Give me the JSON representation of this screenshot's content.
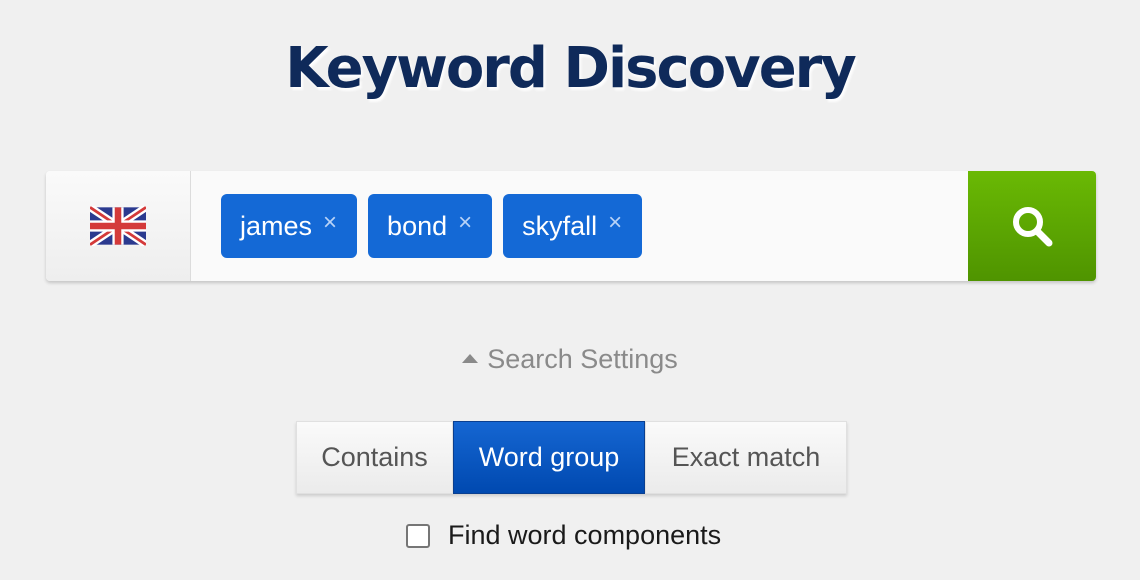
{
  "header": {
    "title": "Keyword Discovery"
  },
  "search": {
    "country_icon": "uk-flag-icon",
    "keywords": [
      {
        "label": "james",
        "remove": "×"
      },
      {
        "label": "bond",
        "remove": "×"
      },
      {
        "label": "skyfall",
        "remove": "×"
      }
    ],
    "search_icon": "search-icon",
    "button_color": "#5fa800",
    "chip_color": "#1469d6"
  },
  "settings": {
    "toggle_label": "Search Settings",
    "match_modes": [
      {
        "label": "Contains",
        "selected": false
      },
      {
        "label": "Word group",
        "selected": true
      },
      {
        "label": "Exact match",
        "selected": false
      }
    ],
    "find_components_label": "Find word components",
    "find_components_checked": false
  },
  "colors": {
    "title": "#0f2a5a",
    "selected_mode": "#0a58c8"
  }
}
